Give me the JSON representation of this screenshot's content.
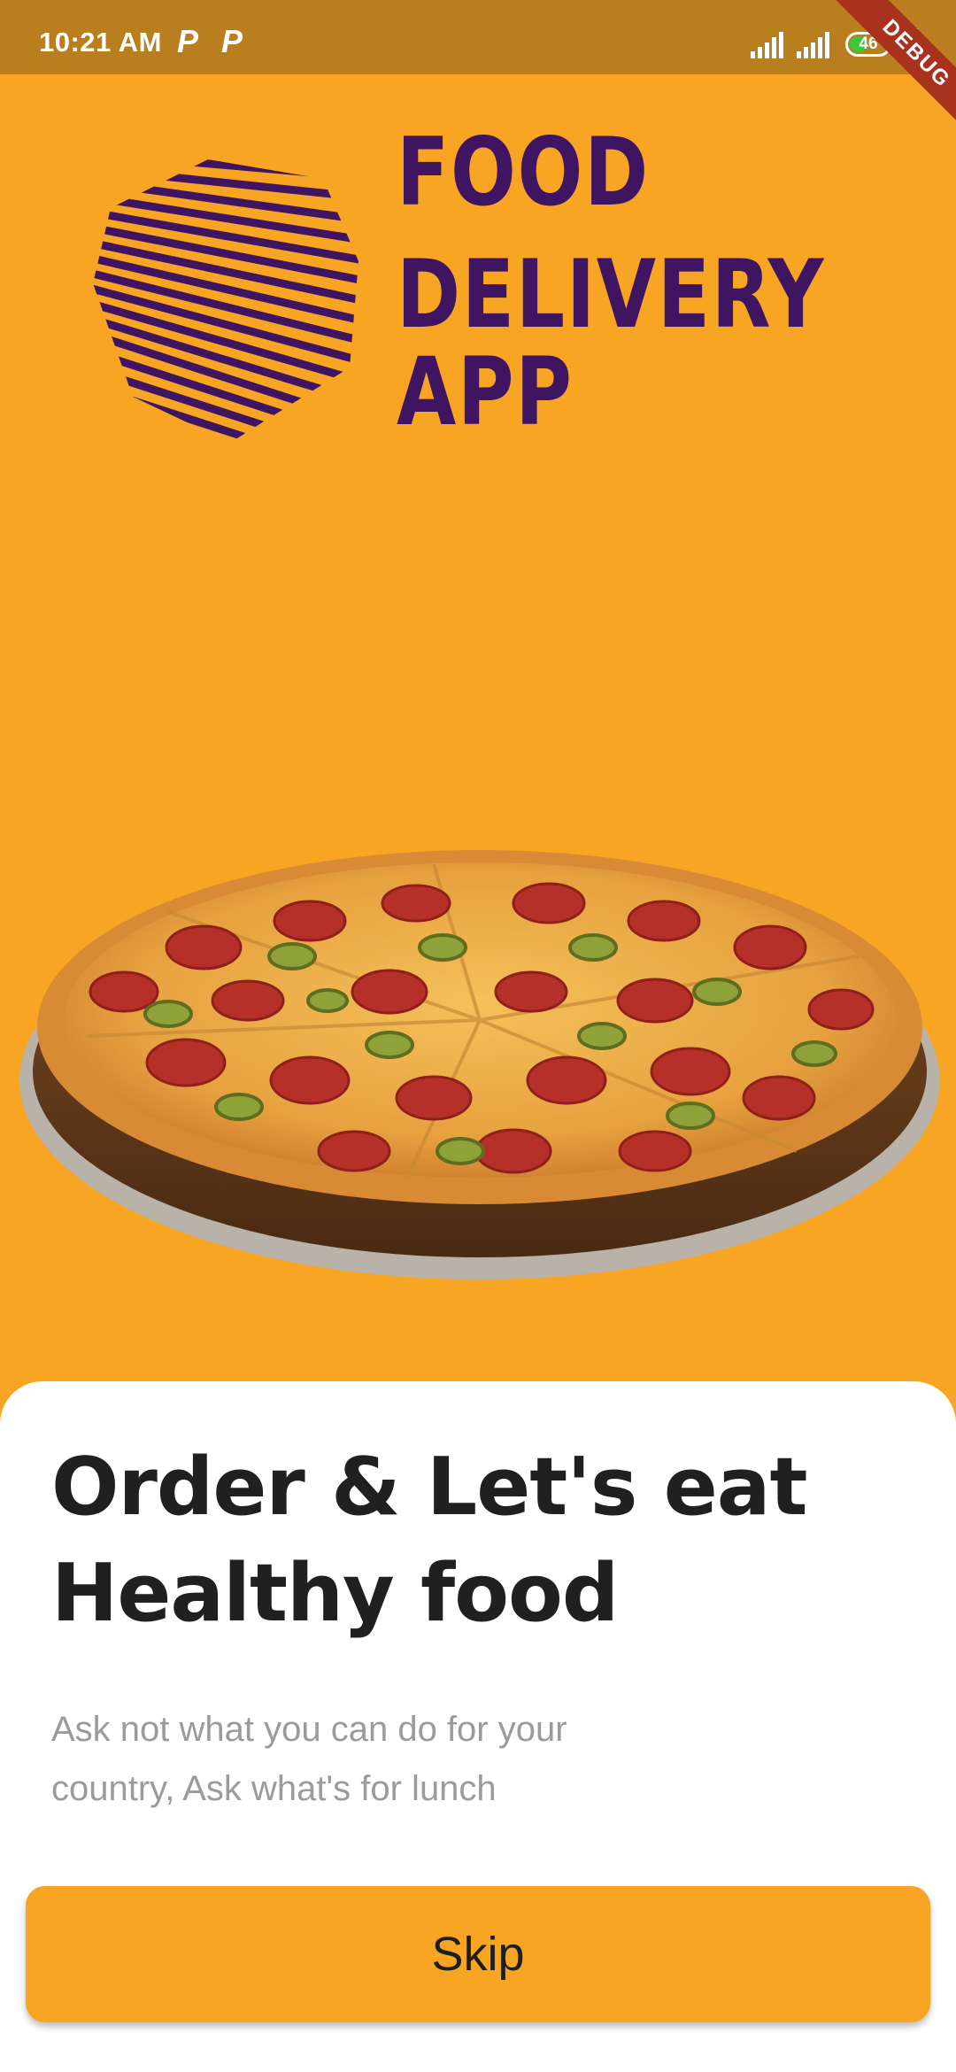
{
  "status_bar": {
    "time": "10:21 AM",
    "notification_icons": [
      "P",
      "P"
    ],
    "battery_level": "46",
    "debug_banner": "DEBUG"
  },
  "logo": {
    "lines": [
      "FOOD",
      "DELIVERY",
      "APP"
    ],
    "color": "#3F1561"
  },
  "hero": {
    "image": "pizza-image"
  },
  "onboarding": {
    "title_line1": "Order & Let's eat",
    "title_line2": "Healthy food",
    "subtitle": "Ask not what you can do for your country, Ask what's for lunch",
    "skip_label": "Skip"
  },
  "colors": {
    "background": "#F7A523",
    "status_bar": "#B97E1E",
    "sheet": "#FFFFFF",
    "button": "#F7A523"
  }
}
